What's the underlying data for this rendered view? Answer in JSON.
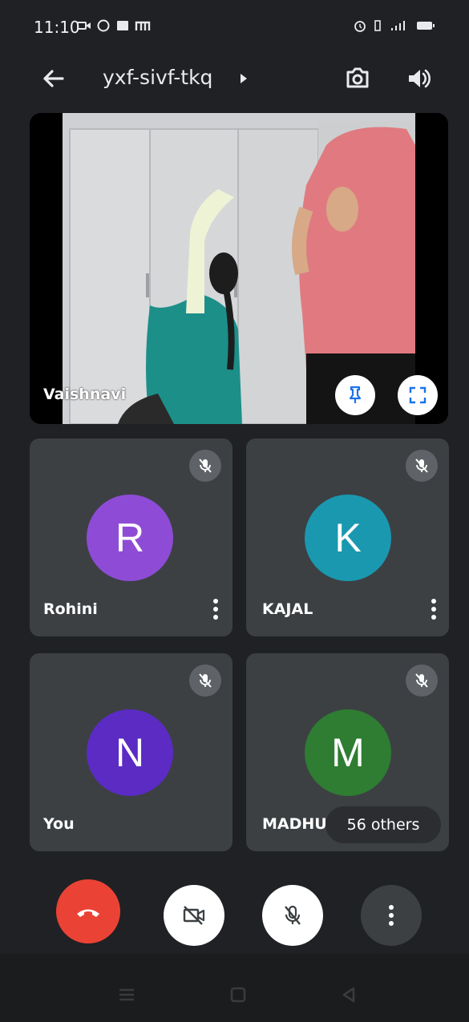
{
  "status_bar": {
    "time": "11:10",
    "icons": [
      "video-icon",
      "whatsapp-icon",
      "message-icon",
      "app-m-icon",
      "alarm-icon",
      "vibrate-icon",
      "signal-icon",
      "battery-icon"
    ]
  },
  "top_bar": {
    "meeting_code": "yxf-sivf-tkq",
    "icons": [
      "back-arrow-icon",
      "switch-camera-icon",
      "speaker-icon"
    ]
  },
  "main_video": {
    "participant_name": "Vaishnavi",
    "icons": [
      "pin-icon",
      "fullscreen-icon"
    ]
  },
  "tiles": [
    {
      "initial": "R",
      "name": "Rohini",
      "avatar_color": "#8e4cd6",
      "muted": true
    },
    {
      "initial": "K",
      "name": "KAJAL",
      "avatar_color": "#1a98b0",
      "muted": true
    },
    {
      "initial": "N",
      "name": "You",
      "avatar_color": "#5b2bc4",
      "muted": true
    },
    {
      "initial": "M",
      "name": "MADHU",
      "avatar_color": "#2e7d32",
      "muted": true
    }
  ],
  "others_chip": "56 others",
  "controls": {
    "end_call_color": "#ea4335",
    "icons": [
      "end-call-icon",
      "camera-off-icon",
      "mic-off-icon",
      "more-options-icon"
    ]
  },
  "colors": {
    "background": "#202124",
    "tile": "#3c4043"
  }
}
